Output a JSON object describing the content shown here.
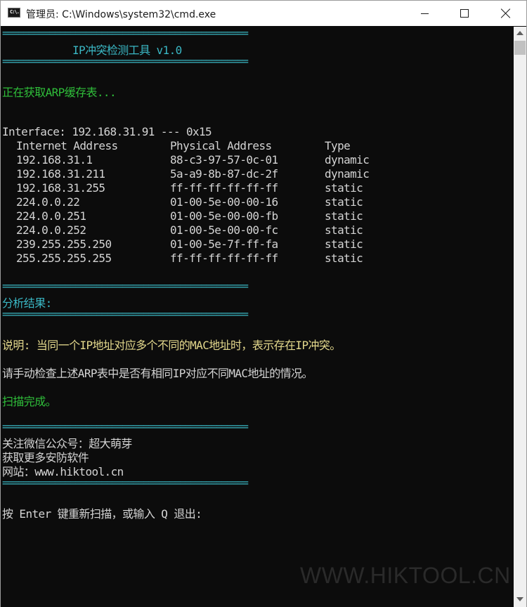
{
  "window": {
    "title": "管理员: C:\\Windows\\system32\\cmd.exe",
    "icon_label": "C:\\."
  },
  "console": {
    "separator": "===============================================",
    "header_title": "IP冲突检测工具 v1.0",
    "fetching": "正在获取ARP缓存表...",
    "interface_line": "Interface: 192.168.31.91 --- 0x15",
    "table_headers": [
      "Internet Address",
      "Physical Address",
      "Type"
    ],
    "arp_entries": [
      {
        "ip": "192.168.31.1",
        "mac": "88-c3-97-57-0c-01",
        "type": "dynamic"
      },
      {
        "ip": "192.168.31.211",
        "mac": "5a-a9-8b-87-dc-2f",
        "type": "dynamic"
      },
      {
        "ip": "192.168.31.255",
        "mac": "ff-ff-ff-ff-ff-ff",
        "type": "static"
      },
      {
        "ip": "224.0.0.22",
        "mac": "01-00-5e-00-00-16",
        "type": "static"
      },
      {
        "ip": "224.0.0.251",
        "mac": "01-00-5e-00-00-fb",
        "type": "static"
      },
      {
        "ip": "224.0.0.252",
        "mac": "01-00-5e-00-00-fc",
        "type": "static"
      },
      {
        "ip": "239.255.255.250",
        "mac": "01-00-5e-7f-ff-fa",
        "type": "static"
      },
      {
        "ip": "255.255.255.255",
        "mac": "ff-ff-ff-ff-ff-ff",
        "type": "static"
      }
    ],
    "analysis_title": "分析结果:",
    "explanation": "说明: 当同一个IP地址对应多个不同的MAC地址时，表示存在IP冲突。",
    "instruction": "请手动检查上述ARP表中是否有相同IP对应不同MAC地址的情况。",
    "scan_done": "扫描完成。",
    "follow_wechat": "关注微信公众号：超大萌芽",
    "more_software": "获取更多安防软件",
    "website": "网站：www.hiktool.cn",
    "prompt": "按 Enter 键重新扫描，或输入 Q 退出:"
  },
  "watermark": "WWW.HIKTOOL.CN",
  "colors": {
    "console_bg": "#0c0c0c",
    "cyan": "#3ab7c4",
    "green": "#2fbe3a",
    "yellow": "#e4d98d",
    "white": "#d4d4d4"
  },
  "icons": {
    "app": "cmd-icon",
    "minimize": "minimize-icon",
    "maximize": "maximize-icon",
    "close": "close-icon"
  }
}
